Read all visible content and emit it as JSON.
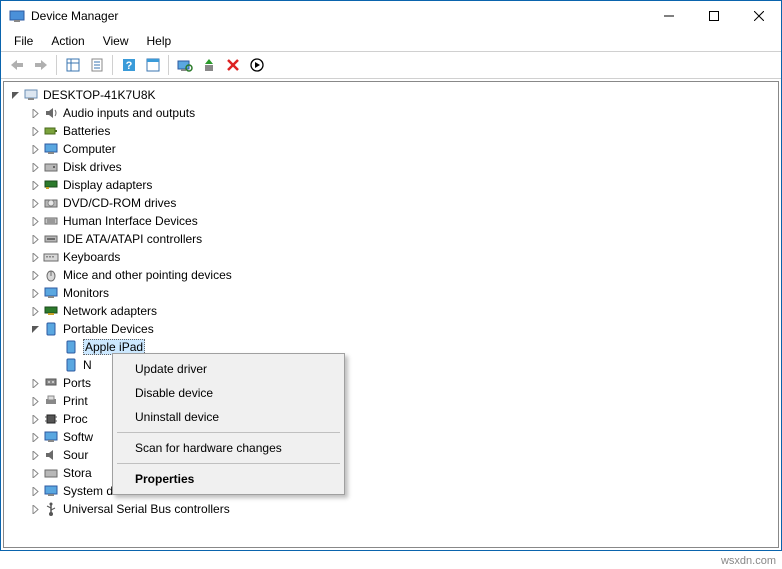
{
  "window": {
    "title": "Device Manager"
  },
  "menu": {
    "file": "File",
    "action": "Action",
    "view": "View",
    "help": "Help"
  },
  "tree": {
    "root": "DESKTOP-41K7U8K",
    "audio": "Audio inputs and outputs",
    "batteries": "Batteries",
    "computer": "Computer",
    "diskdrives": "Disk drives",
    "displayadapters": "Display adapters",
    "dvd": "DVD/CD-ROM drives",
    "hid": "Human Interface Devices",
    "ide": "IDE ATA/ATAPI controllers",
    "keyboards": "Keyboards",
    "mice": "Mice and other pointing devices",
    "monitors": "Monitors",
    "network": "Network adapters",
    "portable": "Portable Devices",
    "portable_child1": "Apple iPad",
    "portable_child2_prefix": "N",
    "ports": "Ports",
    "print": "Print",
    "proc": "Proc",
    "softw": "Softw",
    "sour": "Sour",
    "stora": "Stora",
    "system": "System devices",
    "usb": "Universal Serial Bus controllers"
  },
  "context_menu": {
    "update": "Update driver",
    "disable": "Disable device",
    "uninstall": "Uninstall device",
    "scan": "Scan for hardware changes",
    "properties": "Properties"
  },
  "watermark": "wsxdn.com"
}
